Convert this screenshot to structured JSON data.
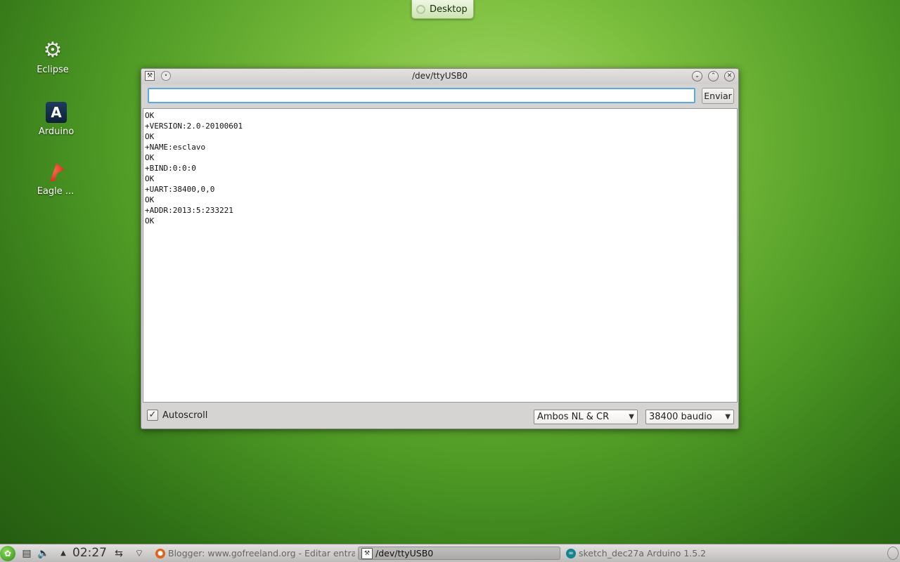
{
  "desktop_tab": {
    "label": "Desktop"
  },
  "desktop_icons": [
    {
      "label": "Eclipse",
      "icon": "gear-icon"
    },
    {
      "label": "Arduino",
      "icon": "arduino-icon",
      "glyph": "A"
    },
    {
      "label": "Eagle ...",
      "icon": "eagle-icon"
    }
  ],
  "window": {
    "title": "/dev/ttyUSB0",
    "send_input_value": "",
    "send_button_label": "Enviar",
    "output_lines": [
      "OK",
      "+VERSION:2.0-20100601",
      "OK",
      "+NAME:esclavo",
      "OK",
      "+BIND:0:0:0",
      "OK",
      "+UART:38400,0,0",
      "OK",
      "+ADDR:2013:5:233221",
      "OK"
    ],
    "autoscroll_label": "Autoscroll",
    "autoscroll_checked": true,
    "line_ending": "Ambos NL & CR",
    "baud_rate": "38400 baudio"
  },
  "taskbar": {
    "clock": "02:27",
    "tasks": [
      {
        "label": "Blogger: www.gofreeland.org - Editar entrada",
        "icon": "firefox-icon",
        "active": false
      },
      {
        "label": "/dev/ttyUSB0",
        "icon": "serial-monitor-icon",
        "active": true
      },
      {
        "label": "sketch_dec27a Arduino 1.5.2",
        "icon": "arduino-icon",
        "active": false
      }
    ]
  },
  "colors": {
    "desktop_green": "#4e9a25",
    "input_focus": "#5aa9e6",
    "window_bg": "#d6d4d2"
  }
}
